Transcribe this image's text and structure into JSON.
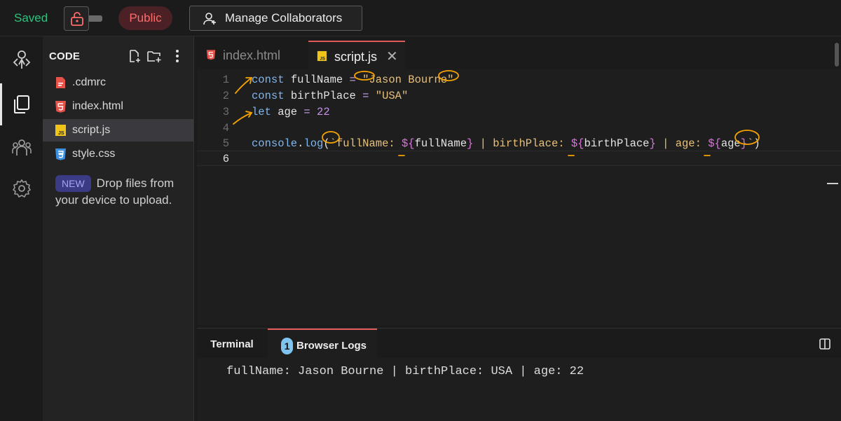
{
  "topbar": {
    "status": "Saved",
    "visibility": "Public",
    "manage_collaborators": "Manage Collaborators"
  },
  "rail": {
    "items": [
      "logo-icon",
      "files-icon",
      "collaborators-icon",
      "settings-icon"
    ]
  },
  "files": {
    "heading": "CODE",
    "items": [
      {
        "name": ".cdmrc",
        "icon": "config-file-icon"
      },
      {
        "name": "index.html",
        "icon": "html-file-icon"
      },
      {
        "name": "script.js",
        "icon": "js-file-icon",
        "active": true
      },
      {
        "name": "style.css",
        "icon": "css-file-icon"
      }
    ],
    "new_badge": "NEW",
    "drop_hint": "Drop files from your device to upload."
  },
  "editor": {
    "tabs": [
      {
        "label": "index.html",
        "icon": "html-file-icon"
      },
      {
        "label": "script.js",
        "icon": "js-file-icon",
        "active": true
      }
    ],
    "line_numbers": [
      "1",
      "2",
      "3",
      "4",
      "5",
      "6"
    ],
    "lines": [
      "const fullName = \"Jason Bourne\"",
      "const birthPlace = \"USA\"",
      "let age = 22",
      "",
      "console.log(`fullName: ${fullName} | birthPlace: ${birthPlace} | age: ${age}`)",
      ""
    ],
    "current_line": 6
  },
  "panel": {
    "tabs": [
      "Terminal",
      "Browser Logs"
    ],
    "log_count": "1",
    "log_output": "fullName: Jason Bourne | birthPlace: USA | age: 22"
  },
  "colors": {
    "accent_red": "#e05a5a",
    "saved_green": "#2ec27e",
    "annotation_orange": "#f5a300"
  }
}
